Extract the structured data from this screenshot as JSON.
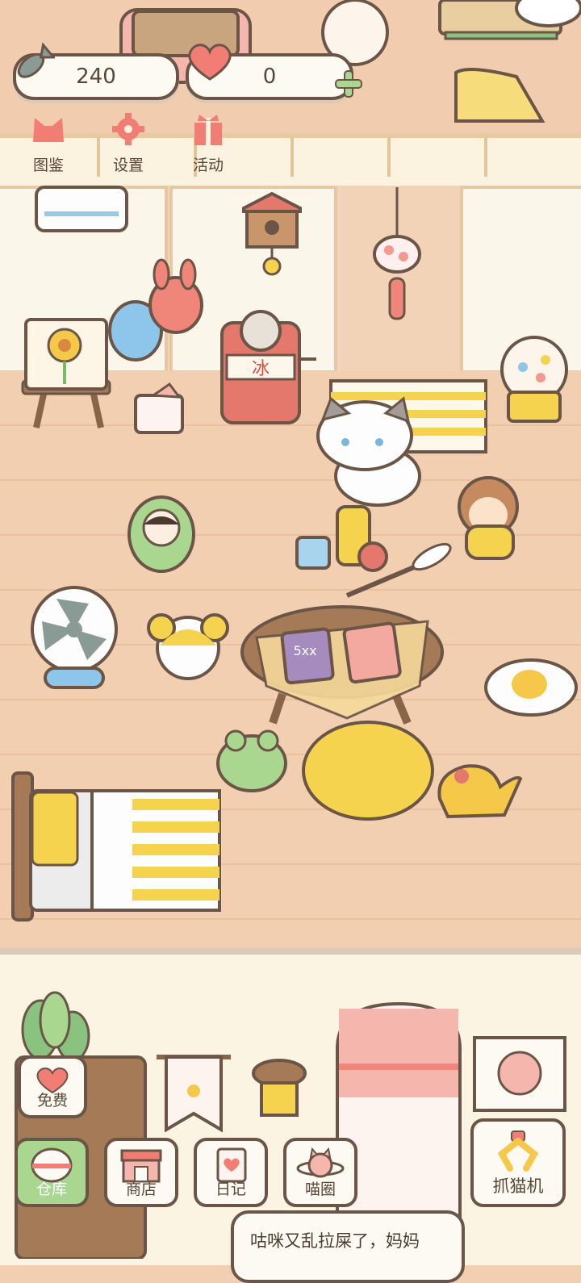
{
  "currency": {
    "fish_count": "240",
    "heart_count": "0"
  },
  "top_buttons": [
    {
      "label": "图鉴",
      "icon": "cat-head-icon"
    },
    {
      "label": "设置",
      "icon": "gear-icon"
    },
    {
      "label": "活动",
      "icon": "gift-icon"
    }
  ],
  "bottom_buttons": [
    {
      "label": "仓库",
      "icon": "storage-bowl-icon"
    },
    {
      "label": "商店",
      "icon": "shop-icon"
    },
    {
      "label": "日记",
      "icon": "diary-icon"
    },
    {
      "label": "喵圈",
      "icon": "cat-planet-icon"
    }
  ],
  "free_button": {
    "label": "免费",
    "icon": "heart-icon"
  },
  "claw_button": {
    "label": "抓猫机",
    "icon": "claw-icon"
  },
  "speech_bubble": "咕咪又乱拉屎了，妈妈",
  "decor": {
    "shaved_ice_sign": "冰",
    "book_label": "5xx"
  },
  "colors": {
    "outline": "#6a5546",
    "card": "#fdfaf3",
    "heart_pink": "#f27d74",
    "accent_green": "#a9d78f",
    "floor": "#f3cfb2"
  }
}
